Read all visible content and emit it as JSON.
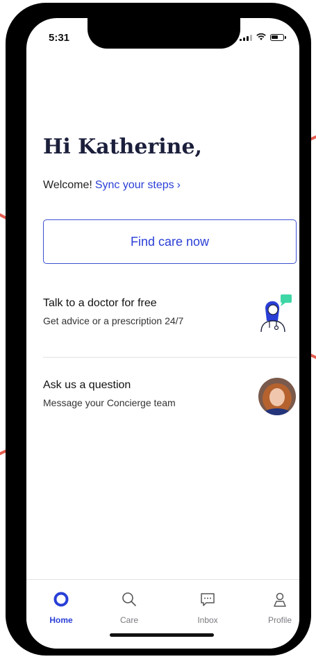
{
  "status_bar": {
    "time": "5:31"
  },
  "greeting": "Hi Katherine,",
  "welcome": {
    "text": "Welcome!",
    "link": "Sync your steps",
    "chevron": "›"
  },
  "find_care_button": "Find care now",
  "cards": [
    {
      "title": "Talk to a doctor for free",
      "subtitle": "Get advice or a prescription 24/7",
      "icon": "doctor-illustration"
    },
    {
      "title": "Ask us a question",
      "subtitle": "Message your Concierge team",
      "icon": "concierge-avatar"
    }
  ],
  "tabs": [
    {
      "label": "Home",
      "icon": "home-circle-icon",
      "active": true
    },
    {
      "label": "Care",
      "icon": "search-icon",
      "active": false
    },
    {
      "label": "Inbox",
      "icon": "chat-bubble-icon",
      "active": false
    },
    {
      "label": "Profile",
      "icon": "person-icon",
      "active": false
    }
  ],
  "colors": {
    "accent": "#2a3fd6",
    "heading": "#1b1f3b",
    "annotation": "#e35b4d"
  }
}
